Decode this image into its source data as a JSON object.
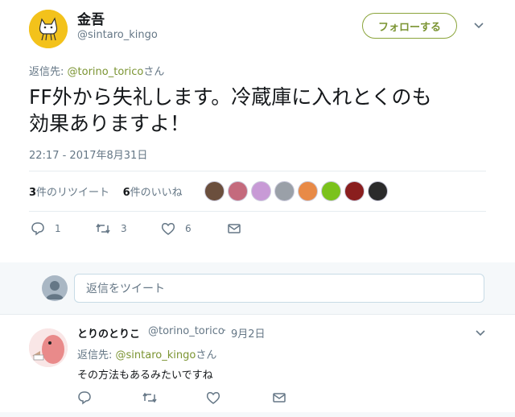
{
  "author": {
    "name": "金吾",
    "handle": "@sintaro_kingo",
    "follow_label": "フォローする"
  },
  "reply_info": {
    "prefix": "返信先: ",
    "to_handle": "@torino_torico",
    "suffix": "さん"
  },
  "tweet": {
    "line1": "FF外から失礼します。冷蔵庫に入れとくのも",
    "line2": "効果ありますよ！",
    "time": "22:17 - 2017年8月31日"
  },
  "stats": {
    "retweets_count": "3",
    "retweets_label": "件のリツイート",
    "likes_count": "6",
    "likes_label": "件のいいね"
  },
  "liker_avatars": [
    {
      "color": "#6b4f3d"
    },
    {
      "color": "#c46a7d"
    },
    {
      "color": "#c89ad6"
    },
    {
      "color": "#9aa0a8"
    },
    {
      "color": "#e88a47"
    },
    {
      "color": "#7bc21c"
    },
    {
      "color": "#8a1e1e"
    },
    {
      "color": "#2b2b2b"
    }
  ],
  "actions": {
    "reply_count": "1",
    "retweet_count": "3",
    "like_count": "6"
  },
  "compose": {
    "placeholder": "返信をツイート"
  },
  "reply": {
    "name": "とりのとりこ",
    "handle": "@torino_torico",
    "date": "9月2日",
    "reply_prefix": "返信先: ",
    "reply_to_handle": "@sintaro_kingo",
    "reply_suffix": "さん",
    "text": "その方法もあるみたいですね"
  },
  "colors": {
    "accent": "#7b9432",
    "gray": "#657786"
  }
}
